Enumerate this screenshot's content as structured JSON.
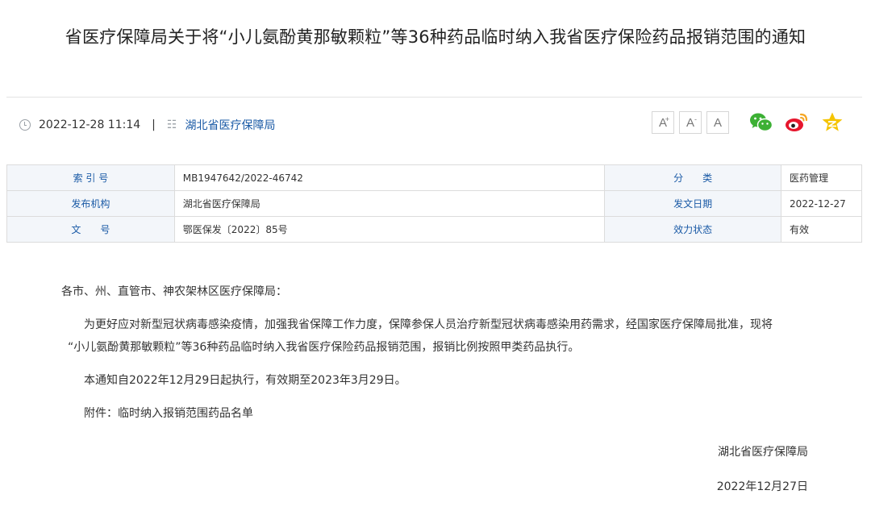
{
  "title": "省医疗保障局关于将“小儿氨酚黄那敏颗粒”等36种药品临时纳入我省医疗保险药品报销范围的通知",
  "meta": {
    "datetime": "2022-12-28 11:14",
    "separator": "|",
    "publisher": "湖北省医疗保障局"
  },
  "font_controls": {
    "large": "A",
    "medium": "A",
    "small": "A",
    "plus": "+",
    "minus": "-"
  },
  "share_icons": [
    "wechat-icon",
    "weibo-icon",
    "qzone-icon"
  ],
  "info_table": [
    {
      "l1": "索 引 号",
      "v1": "MB1947642/2022-46742",
      "l2": "分　　类",
      "v2": "医药管理"
    },
    {
      "l1": "发布机构",
      "v1": "湖北省医疗保障局",
      "l2": "发文日期",
      "v2": "2022-12-27"
    },
    {
      "l1": "文　　号",
      "v1": "鄂医保发〔2022〕85号",
      "l2": "效力状态",
      "v2": "有效"
    }
  ],
  "body": {
    "salutation": "各市、州、直管市、神农架林区医疗保障局：",
    "para1_line1": "为更好应对新型冠状病毒感染疫情，加强我省保障工作力度，保障参保人员治疗新型冠状病毒感染用药需求，经国家医疗保障局批准，现将",
    "para1_line2": "“小儿氨酚黄那敏颗粒”等36种药品临时纳入我省医疗保险药品报销范围，报销比例按照甲类药品执行。",
    "para2": "本通知自2022年12月29日起执行，有效期至2023年3月29日。",
    "attachment": "附件：临时纳入报销范围药品名单",
    "signer": "湖北省医疗保障局",
    "sign_date": "2022年12月27日"
  },
  "colors": {
    "link_blue": "#1a5aa6",
    "table_label_bg": "#f3f6fa",
    "wechat_green": "#3cb034",
    "weibo_red": "#e6162d",
    "qzone_yellow": "#f5c400"
  }
}
